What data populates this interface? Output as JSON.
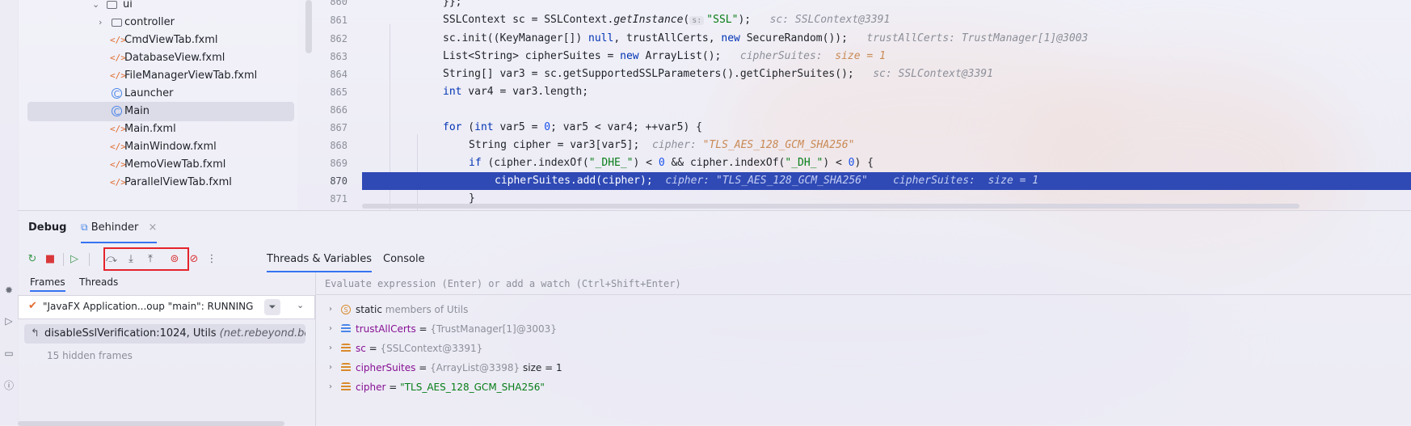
{
  "project_tree": {
    "items": [
      {
        "label": "ui",
        "type": "folder",
        "expanded": true
      },
      {
        "label": "controller",
        "type": "folder",
        "expanded": false
      },
      {
        "label": "CmdViewTab.fxml",
        "type": "fxml"
      },
      {
        "label": "DatabaseView.fxml",
        "type": "fxml"
      },
      {
        "label": "FileManagerViewTab.fxml",
        "type": "fxml"
      },
      {
        "label": "Launcher",
        "type": "class"
      },
      {
        "label": "Main",
        "type": "class",
        "selected": true
      },
      {
        "label": "Main.fxml",
        "type": "fxml"
      },
      {
        "label": "MainWindow.fxml",
        "type": "fxml"
      },
      {
        "label": "MemoViewTab.fxml",
        "type": "fxml"
      },
      {
        "label": "ParallelViewTab.fxml",
        "type": "fxml"
      }
    ]
  },
  "editor": {
    "lines": [
      {
        "num": "860",
        "code": "}};"
      },
      {
        "num": "861",
        "code_a": "SSLContext sc = SSLContext.",
        "code_method": "getInstance",
        "code_b": "(",
        "inlay": "s:",
        "str": "\"SSL\"",
        "code_c": ");",
        "hint": "sc: SSLContext@3391"
      },
      {
        "num": "862",
        "code_a": "sc.init((KeyManager[]) ",
        "kw1": "null",
        "code_b": ", trustAllCerts, ",
        "kw2": "new",
        "code_c": " SecureRandom());",
        "hint": "trustAllCerts: TrustManager[1]@3003"
      },
      {
        "num": "863",
        "code_a": "List<String> cipherSuites = ",
        "kw": "new",
        "code_b": " ArrayList();",
        "hint": "cipherSuites:",
        "hint_val": "size = 1"
      },
      {
        "num": "864",
        "code": "String[] var3 = sc.getSupportedSSLParameters().getCipherSuites();",
        "hint": "sc: SSLContext@3391"
      },
      {
        "num": "865",
        "kw": "int",
        "code": " var4 = var3.length;"
      },
      {
        "num": "866",
        "code": ""
      },
      {
        "num": "867",
        "kw1": "for",
        "code_a": " (",
        "kw2": "int",
        "code_b": " var5 = ",
        "n1": "0",
        "code_c": "; var5 < var4; ++var5) {"
      },
      {
        "num": "868",
        "code": "String cipher = var3[var5];",
        "hint": "cipher:",
        "hint_val": "\"TLS_AES_128_GCM_SHA256\""
      },
      {
        "num": "869",
        "kw": "if",
        "code_a": " (cipher.indexOf(",
        "s1": "\"_DHE_\"",
        "code_b": ") < ",
        "n1": "0",
        "code_c": " && cipher.indexOf(",
        "s2": "\"_DH_\"",
        "code_d": ") < ",
        "n2": "0",
        "code_e": ") {"
      },
      {
        "num": "870",
        "code": "cipherSuites.add(cipher);",
        "hint1": "cipher:",
        "hint1_val": "\"TLS_AES_128_GCM_SHA256\"",
        "hint2": "cipherSuites:",
        "hint2_val": "size = 1",
        "current": true
      },
      {
        "num": "871",
        "code": "}"
      }
    ]
  },
  "debug": {
    "title": "Debug",
    "session_tab": "Behinder",
    "tabs": {
      "threads_variables": "Threads & Variables",
      "console": "Console"
    },
    "frames_tab": "Frames",
    "threads_tab": "Threads",
    "thread_selector": "\"JavaFX Application...oup \"main\": RUNNING",
    "current_frame": "disableSslVerification:1024, Utils",
    "current_frame_pkg": "(net.rebeyond.behinder.",
    "hidden_frames": "15 hidden frames",
    "eval_placeholder": "Evaluate expression (Enter) or add a watch (Ctrl+Shift+Enter)",
    "variables": [
      {
        "kind": "static",
        "name": "static",
        "value": "members of Utils"
      },
      {
        "kind": "list",
        "name": "trustAllCerts",
        "eq": " = ",
        "value": "{TrustManager[1]@3003}"
      },
      {
        "kind": "field",
        "name": "sc",
        "eq": " = ",
        "value": "{SSLContext@3391}"
      },
      {
        "kind": "field",
        "name": "cipherSuites",
        "eq": " = ",
        "value": "{ArrayList@3398}",
        "extra": "size = 1"
      },
      {
        "kind": "field",
        "name": "cipher",
        "eq": " = ",
        "value": "\"TLS_AES_128_GCM_SHA256\""
      }
    ]
  },
  "colors": {
    "accent": "#3574f0",
    "exec_line": "#2f4ab5",
    "highlight_box": "#e5232b"
  }
}
